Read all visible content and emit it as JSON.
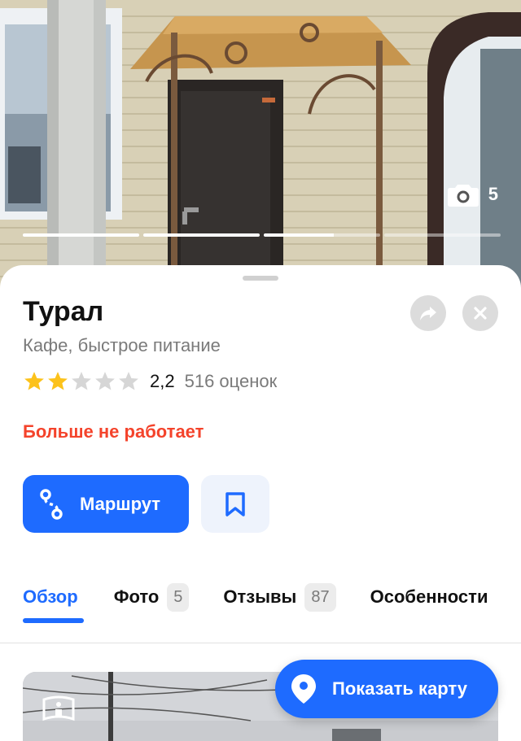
{
  "hero": {
    "photo_count": "5",
    "icons": {
      "camera": "camera-icon"
    },
    "progress": [
      1,
      1,
      0.6,
      0
    ]
  },
  "place": {
    "title": "Турал",
    "category": "Кафе, быстрое питание",
    "rating": {
      "stars_filled": 2,
      "stars_total": 5,
      "value": "2,2",
      "count_label": "516 оценок"
    },
    "status": "Больше не работает"
  },
  "actions": {
    "route_label": "Маршрут",
    "icons": {
      "share": "share-icon",
      "close": "close-icon",
      "route": "route-icon",
      "bookmark": "bookmark-icon"
    }
  },
  "tabs": [
    {
      "label": "Обзор",
      "count": null,
      "active": true
    },
    {
      "label": "Фото",
      "count": "5",
      "active": false
    },
    {
      "label": "Отзывы",
      "count": "87",
      "active": false
    },
    {
      "label": "Особенности",
      "count": null,
      "active": false
    }
  ],
  "map_button": {
    "label": "Показать карту",
    "icon": "map-pin-icon"
  },
  "colors": {
    "accent": "#1e6bff",
    "status_closed": "#f4432b",
    "star_filled": "#fcc21b",
    "star_empty": "#d6d6d6"
  }
}
